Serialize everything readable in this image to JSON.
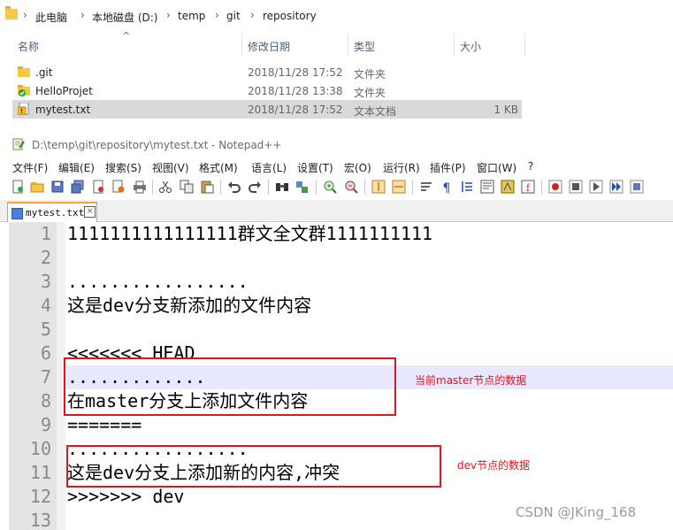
{
  "explorer": {
    "breadcrumbs": [
      "此电脑",
      "本地磁盘 (D:)",
      "temp",
      "git",
      "repository"
    ],
    "columns": {
      "name": "名称",
      "date": "修改日期",
      "type": "类型",
      "size": "大小"
    },
    "files": [
      {
        "name": ".git",
        "date": "2018/11/28 17:52",
        "type": "文件夹",
        "size": "",
        "icon": "folder-icon"
      },
      {
        "name": "HelloProjet",
        "date": "2018/11/28 13:38",
        "type": "文件夹",
        "size": "",
        "icon": "folder-synced-icon"
      },
      {
        "name": "mytest.txt",
        "date": "2018/11/28 17:52",
        "type": "文本文档",
        "size": "1 KB",
        "icon": "text-file-conflict-icon"
      }
    ]
  },
  "npp": {
    "title": "D:\\temp\\git\\repository\\mytest.txt - Notepad++",
    "menus": [
      "文件(F)",
      "编辑(E)",
      "搜索(S)",
      "视图(V)",
      "格式(M)",
      "语言(L)",
      "设置(T)",
      "宏(O)",
      "运行(R)",
      "插件(P)",
      "窗口(W)",
      "?"
    ],
    "tab": {
      "label": "mytest.txt",
      "close": "×"
    },
    "lines": [
      {
        "n": "1",
        "text": "1111111111111111群文全文群1111111111"
      },
      {
        "n": "2",
        "text": ""
      },
      {
        "n": "3",
        "text": "................."
      },
      {
        "n": "4",
        "text": "这是dev分支新添加的文件内容"
      },
      {
        "n": "5",
        "text": ""
      },
      {
        "n": "6",
        "text": "<<<<<<< HEAD"
      },
      {
        "n": "7",
        "text": "............."
      },
      {
        "n": "8",
        "text": "在master分支上添加文件内容"
      },
      {
        "n": "9",
        "text": "======="
      },
      {
        "n": "10",
        "text": "................."
      },
      {
        "n": "11",
        "text": "这是dev分支上添加新的内容,冲突"
      },
      {
        "n": "12",
        "text": ">>>>>>> dev"
      },
      {
        "n": "13",
        "text": ""
      }
    ]
  },
  "annotations": {
    "master": "当前master节点的数据",
    "dev": "dev节点的数据"
  },
  "watermark": "CSDN @JKing_168",
  "colors": {
    "accent": "#e0141e",
    "tab_accent": "#f7a232",
    "current_line": "#e8e8ff"
  }
}
